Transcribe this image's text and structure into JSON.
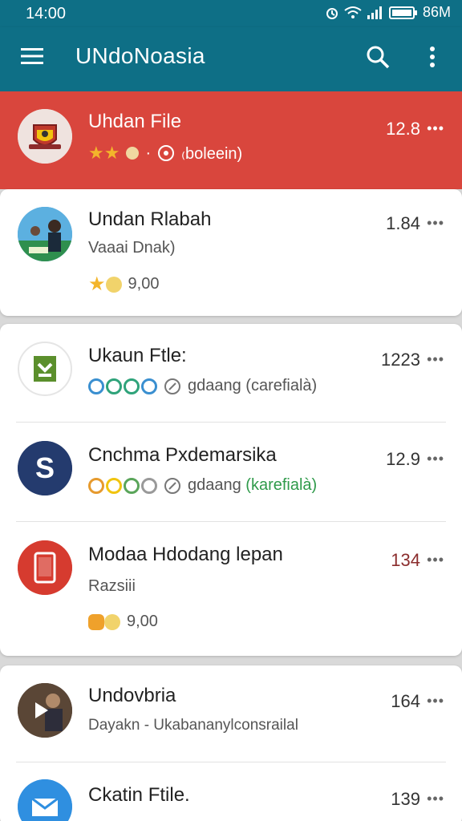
{
  "status": {
    "time": "14:00",
    "battery": "86M"
  },
  "appbar": {
    "title": "UNdoNoasia"
  },
  "items": [
    {
      "name": "Uhdan File",
      "size": "12.8",
      "meta": "₍boleein)"
    },
    {
      "name": "Undan Rlabah",
      "sub": "Vaaai Dnak)",
      "size": "1.84",
      "price": "9,00"
    },
    {
      "name": "Ukaun Ftle:",
      "size": "1223",
      "meta": "gdaang (carefialà)"
    },
    {
      "name": "Cnchma Pxdemarsika",
      "size": "12.9",
      "meta_prefix": "gdaang ",
      "meta_green": "(karefialà)"
    },
    {
      "name": "Modaa Hdodang lepan",
      "sub": "Razsiii",
      "size": "134",
      "price": "9,00"
    },
    {
      "name": "Undovbria",
      "sub": "Dayakn - Ukabananylconsrailal",
      "size": "164"
    },
    {
      "name": "Ckatin Ftile.",
      "size": "139"
    }
  ]
}
